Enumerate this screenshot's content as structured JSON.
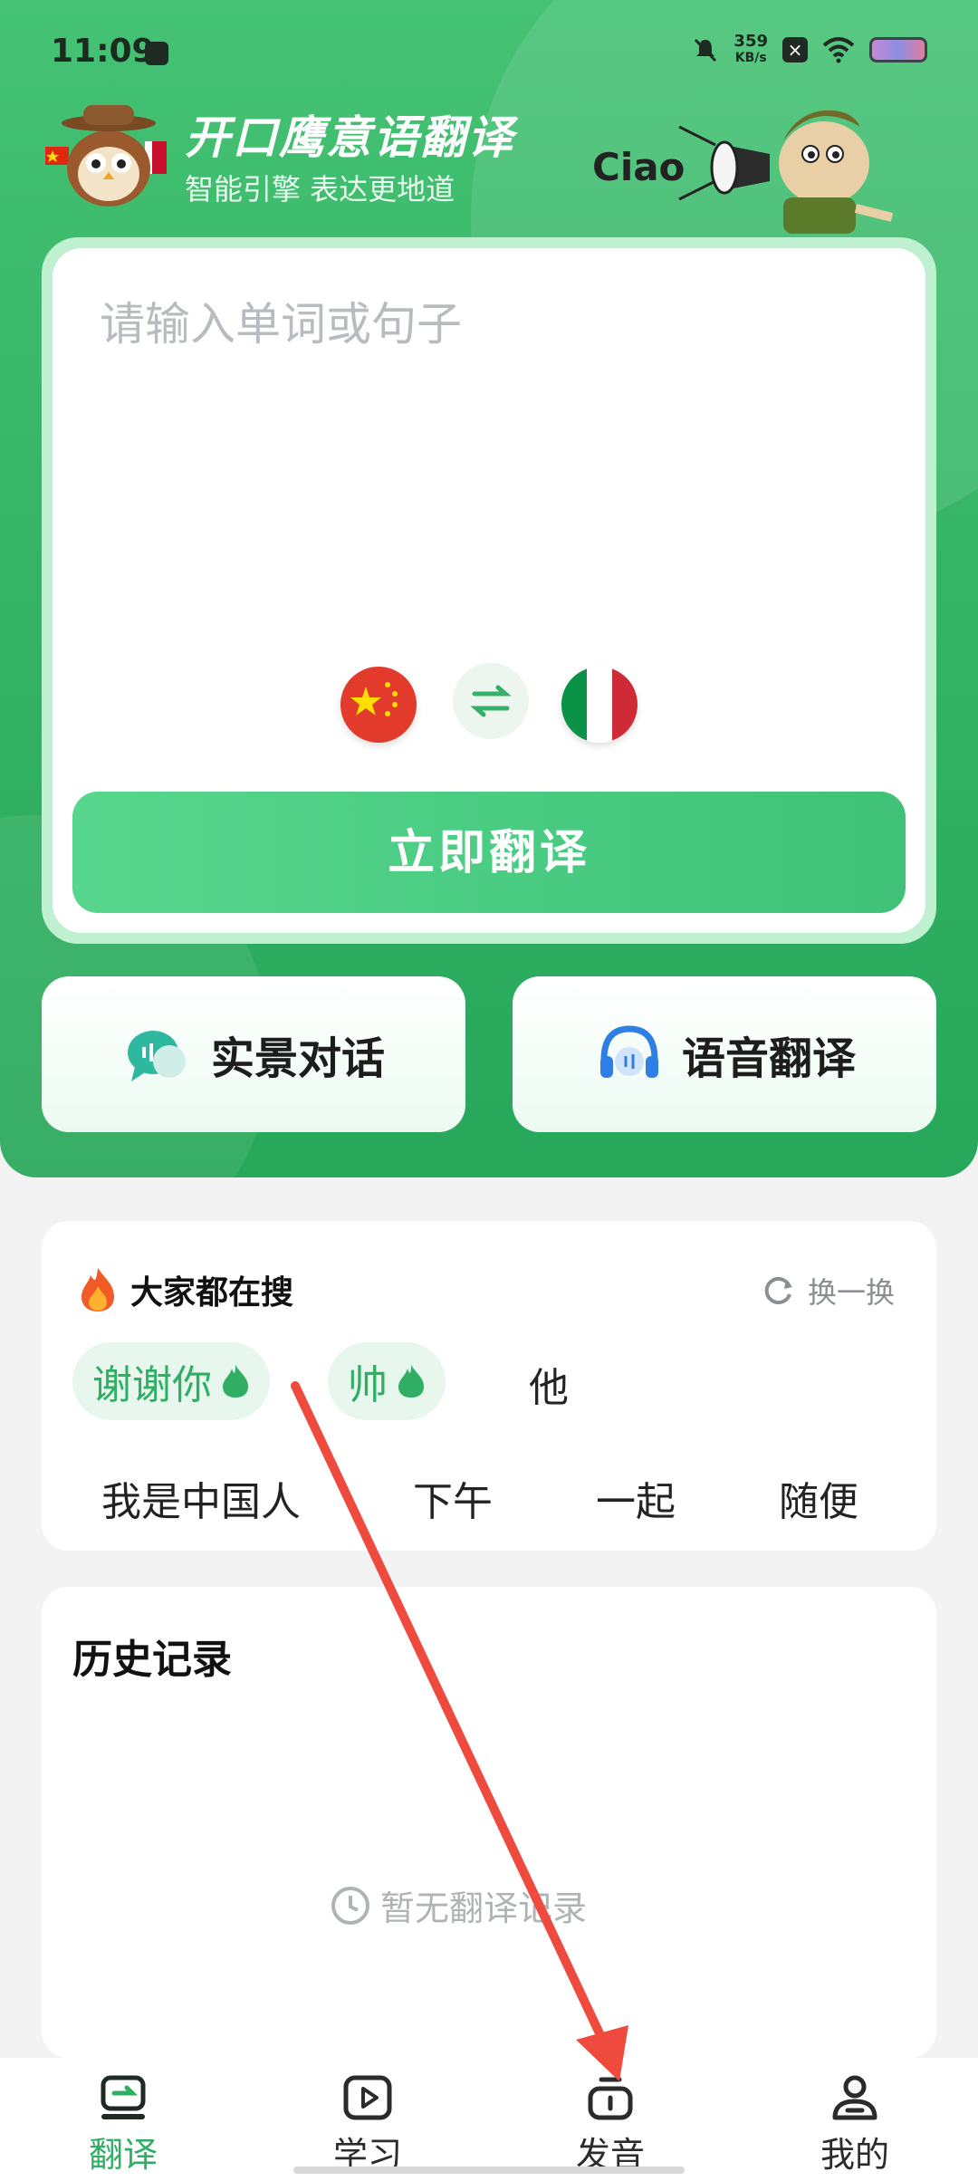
{
  "status_bar": {
    "time": "11:09",
    "net_speed_value": "359",
    "net_speed_unit": "KB/s"
  },
  "header": {
    "title": "开口鹰意语翻译",
    "subtitle": "智能引擎 表达更地道",
    "mascot_text": "Ciao"
  },
  "translator": {
    "input_placeholder": "请输入单词或句子",
    "source_language_flag": "china-flag",
    "target_language_flag": "italy-flag",
    "translate_button": "立即翻译"
  },
  "features": {
    "scene_dialog": "实景对话",
    "voice_translate": "语音翻译"
  },
  "hot_search": {
    "title": "大家都在搜",
    "refresh_label": "换一换",
    "hot_chips": [
      "谢谢你",
      "帅"
    ],
    "words": [
      "他",
      "我是中国人",
      "下午",
      "一起",
      "随便"
    ]
  },
  "history": {
    "title": "历史记录",
    "empty_text": "暂无翻译记录"
  },
  "tabbar": {
    "items": [
      {
        "label": "翻译",
        "active": true
      },
      {
        "label": "学习",
        "active": false
      },
      {
        "label": "发音",
        "active": false
      },
      {
        "label": "我的",
        "active": false
      }
    ]
  },
  "colors": {
    "brand_green": "#2fae64",
    "hero_green": "#36b566",
    "annotation_arrow": "#ee4b3e"
  }
}
